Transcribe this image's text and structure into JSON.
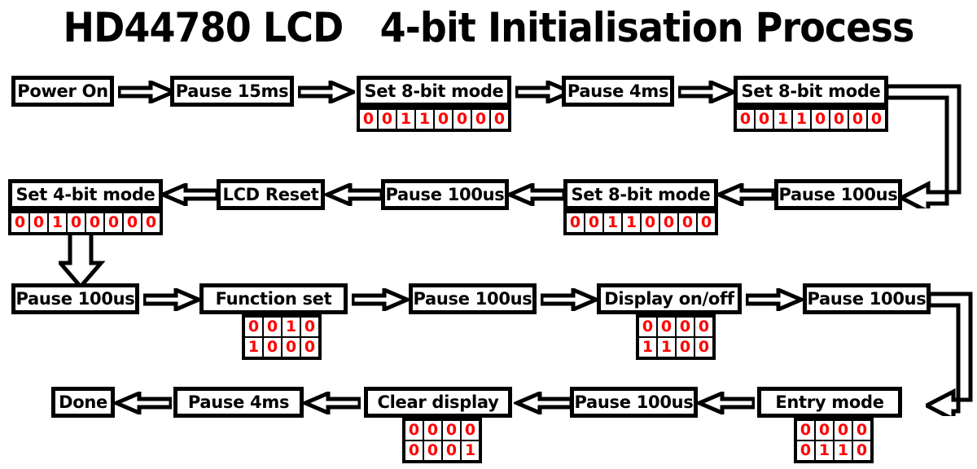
{
  "title": "HD44780 LCD   4-bit Initialisation Process",
  "colors": {
    "outline": "#000000",
    "background": "#ffffff",
    "bit_text": "#ff0000",
    "node_text": "#000000"
  },
  "diagram": {
    "type": "flowchart",
    "direction": "boustrophedon",
    "rows": [
      {
        "index": 1,
        "flow": "left-to-right",
        "nodes": [
          {
            "id": "power-on",
            "label": "Power On",
            "bits": null
          },
          {
            "id": "pause-15ms",
            "label": "Pause 15ms",
            "bits": null
          },
          {
            "id": "set-8bit-1",
            "label": "Set 8-bit mode",
            "bits": [
              [
                "0",
                "0",
                "1",
                "1",
                "0",
                "0",
                "0",
                "0"
              ]
            ]
          },
          {
            "id": "pause-4ms-1",
            "label": "Pause 4ms",
            "bits": null
          },
          {
            "id": "set-8bit-2",
            "label": "Set 8-bit mode",
            "bits": [
              [
                "0",
                "0",
                "1",
                "1",
                "0",
                "0",
                "0",
                "0"
              ]
            ]
          }
        ]
      },
      {
        "index": 2,
        "flow": "right-to-left",
        "nodes": [
          {
            "id": "set-4bit",
            "label": "Set 4-bit mode",
            "bits": [
              [
                "0",
                "0",
                "1",
                "0",
                "0",
                "0",
                "0",
                "0"
              ]
            ]
          },
          {
            "id": "lcd-reset",
            "label": "LCD Reset",
            "bits": null
          },
          {
            "id": "pause-100us-1",
            "label": "Pause 100us",
            "bits": null
          },
          {
            "id": "set-8bit-3",
            "label": "Set 8-bit mode",
            "bits": [
              [
                "0",
                "0",
                "1",
                "1",
                "0",
                "0",
                "0",
                "0"
              ]
            ]
          },
          {
            "id": "pause-100us-2",
            "label": "Pause 100us",
            "bits": null
          }
        ]
      },
      {
        "index": 3,
        "flow": "left-to-right",
        "nodes": [
          {
            "id": "pause-100us-3",
            "label": "Pause 100us",
            "bits": null
          },
          {
            "id": "function-set",
            "label": "Function set",
            "bits": [
              [
                "0",
                "0",
                "1",
                "0"
              ],
              [
                "1",
                "0",
                "0",
                "0"
              ]
            ]
          },
          {
            "id": "pause-100us-4",
            "label": "Pause 100us",
            "bits": null
          },
          {
            "id": "display-on-off",
            "label": "Display on/off",
            "bits": [
              [
                "0",
                "0",
                "0",
                "0"
              ],
              [
                "1",
                "1",
                "0",
                "0"
              ]
            ]
          },
          {
            "id": "pause-100us-5",
            "label": "Pause 100us",
            "bits": null
          }
        ]
      },
      {
        "index": 4,
        "flow": "right-to-left",
        "nodes": [
          {
            "id": "done",
            "label": "Done",
            "bits": null
          },
          {
            "id": "pause-4ms-2",
            "label": "Pause 4ms",
            "bits": null
          },
          {
            "id": "clear-display",
            "label": "Clear display",
            "bits": [
              [
                "0",
                "0",
                "0",
                "0"
              ],
              [
                "0",
                "0",
                "0",
                "1"
              ]
            ]
          },
          {
            "id": "pause-100us-6",
            "label": "Pause 100us",
            "bits": null
          },
          {
            "id": "entry-mode",
            "label": "Entry mode",
            "bits": [
              [
                "0",
                "0",
                "0",
                "0"
              ],
              [
                "0",
                "1",
                "1",
                "0"
              ]
            ]
          }
        ]
      }
    ],
    "connectors": [
      {
        "id": "row1-to-row2",
        "kind": "wrap-right",
        "from": "set-8bit-2",
        "to": "pause-100us-2"
      },
      {
        "id": "row2-to-row3",
        "kind": "down-arrow",
        "from": "set-4bit",
        "to": "pause-100us-3"
      },
      {
        "id": "row3-to-row4",
        "kind": "wrap-right",
        "from": "pause-100us-5",
        "to": "entry-mode"
      }
    ]
  }
}
